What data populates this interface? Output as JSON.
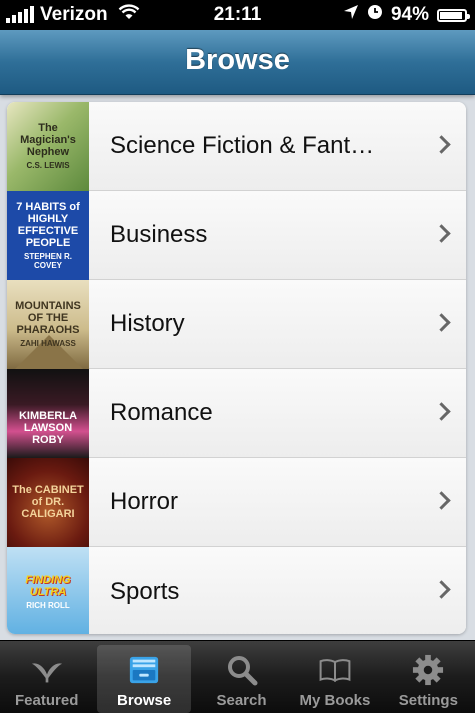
{
  "status_bar": {
    "carrier": "Verizon",
    "time": "21:11",
    "battery": "94%",
    "battery_level": 0.94
  },
  "nav": {
    "title": "Browse"
  },
  "categories": [
    {
      "label": "Science Fiction & Fant…",
      "cover_title": "The Magician's Nephew",
      "cover_author": "C.S. LEWIS"
    },
    {
      "label": "Business",
      "cover_title": "7 HABITS of HIGHLY EFFECTIVE PEOPLE",
      "cover_author": "STEPHEN R. COVEY"
    },
    {
      "label": "History",
      "cover_title": "MOUNTAINS OF THE PHARAOHS",
      "cover_author": "ZAHI HAWASS"
    },
    {
      "label": "Romance",
      "cover_title": "KIMBERLA LAWSON ROBY",
      "cover_author": ""
    },
    {
      "label": "Horror",
      "cover_title": "The CABINET of DR. CALIGARI",
      "cover_author": ""
    },
    {
      "label": "Sports",
      "cover_title": "FINDING ULTRA",
      "cover_author": "RICH ROLL"
    }
  ],
  "tabs": [
    {
      "label": "Featured",
      "icon": "featured-icon",
      "active": false
    },
    {
      "label": "Browse",
      "icon": "browse-icon",
      "active": true
    },
    {
      "label": "Search",
      "icon": "search-icon",
      "active": false
    },
    {
      "label": "My Books",
      "icon": "my-books-icon",
      "active": false
    },
    {
      "label": "Settings",
      "icon": "settings-icon",
      "active": false
    }
  ],
  "colors": {
    "nav_bar": "#2f6f98",
    "tab_bar": "#1c1c1c",
    "active_tab_text": "#ffffff",
    "inactive_tab_text": "#9a9a9a"
  }
}
